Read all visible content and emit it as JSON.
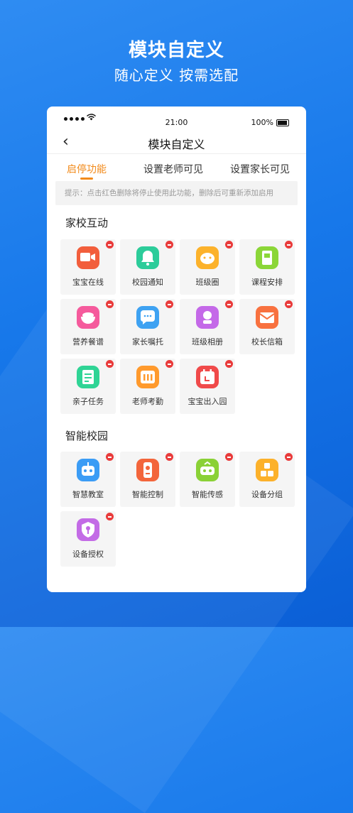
{
  "header": {
    "title": "模块自定义",
    "subtitle": "随心定义 按需选配"
  },
  "status_bar": {
    "time": "21:00",
    "battery": "100%"
  },
  "nav": {
    "back_icon": "‹",
    "title": "模块自定义"
  },
  "tabs": [
    {
      "label": "启停功能",
      "active": true
    },
    {
      "label": "设置老师可见",
      "active": false
    },
    {
      "label": "设置家长可见",
      "active": false
    }
  ],
  "tip": "提示：点击红色删除将停止使用此功能，删除后可重新添加启用",
  "sections": [
    {
      "title": "家校互动",
      "items": [
        {
          "label": "宝宝在线",
          "icon": "video-camera-icon",
          "color": "#f25e3c"
        },
        {
          "label": "校园通知",
          "icon": "bell-icon",
          "color": "#2ccc9a"
        },
        {
          "label": "班级圈",
          "icon": "cloud-circle-icon",
          "color": "#fcb22b"
        },
        {
          "label": "课程安排",
          "icon": "book-icon",
          "color": "#8bd638"
        },
        {
          "label": "营养餐谱",
          "icon": "bowl-icon",
          "color": "#f55a9c"
        },
        {
          "label": "家长嘱托",
          "icon": "chat-bubble-icon",
          "color": "#3ea2f2"
        },
        {
          "label": "班级相册",
          "icon": "flower-album-icon",
          "color": "#c469e8"
        },
        {
          "label": "校长信箱",
          "icon": "envelope-icon",
          "color": "#f8713f"
        },
        {
          "label": "亲子任务",
          "icon": "task-list-icon",
          "color": "#2fd495"
        },
        {
          "label": "老师考勤",
          "icon": "attendance-icon",
          "color": "#ff9a2d"
        },
        {
          "label": "宝宝出入园",
          "icon": "calendar-icon",
          "color": "#f04a4a"
        }
      ]
    },
    {
      "title": "智能校园",
      "items": [
        {
          "label": "智慧教室",
          "icon": "robot-icon",
          "color": "#3b9cf5"
        },
        {
          "label": "智能控制",
          "icon": "remote-control-icon",
          "color": "#f3653b"
        },
        {
          "label": "智能传感",
          "icon": "sensor-icon",
          "color": "#8ad136"
        },
        {
          "label": "设备分组",
          "icon": "cubes-icon",
          "color": "#fcb12a"
        },
        {
          "label": "设备授权",
          "icon": "key-shield-icon",
          "color": "#c36be6"
        }
      ]
    }
  ]
}
